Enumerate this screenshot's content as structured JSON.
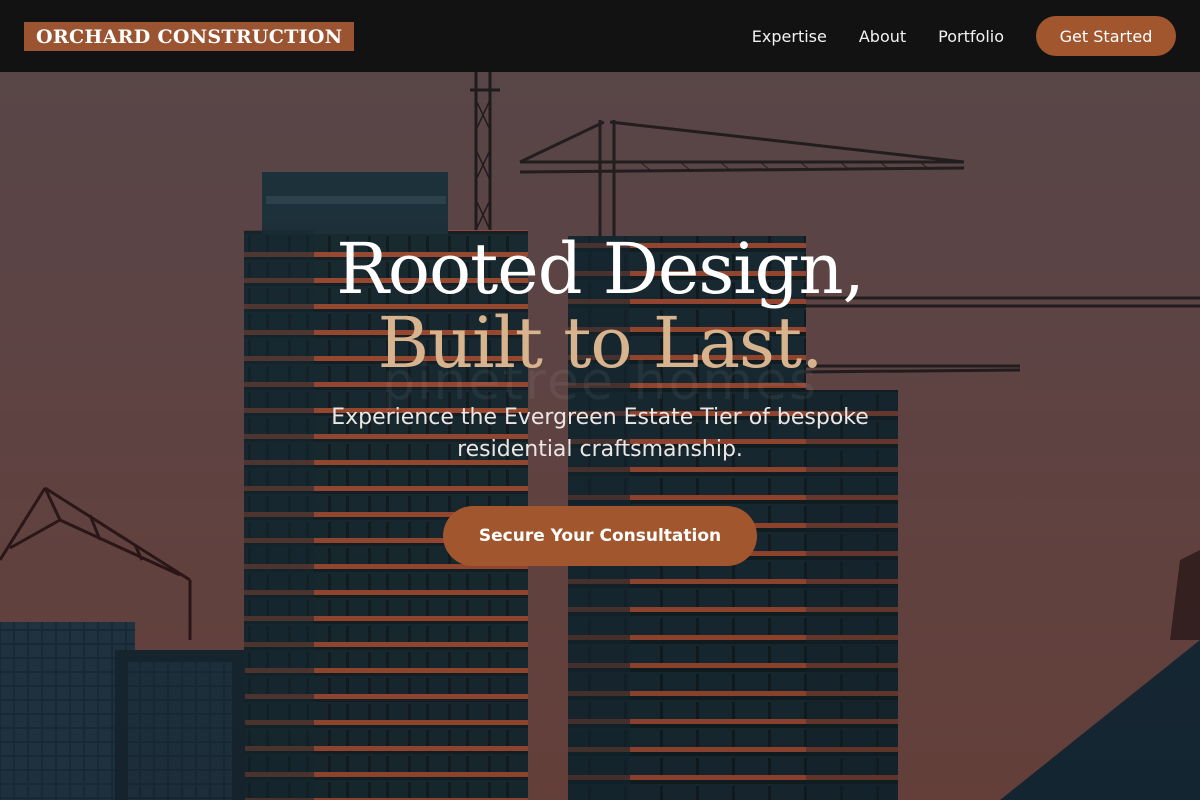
{
  "brand": {
    "name": "ORCHARD CONSTRUCTION",
    "color": "#9a5431"
  },
  "nav": {
    "links": [
      {
        "label": "Expertise"
      },
      {
        "label": "About"
      },
      {
        "label": "Portfolio"
      }
    ],
    "cta_label": "Get Started"
  },
  "hero": {
    "headline_line_1": "Rooted Design,",
    "headline_line_2": "Built to Last.",
    "subheadline": "Experience the Evergreen Estate Tier of bespoke residential craftsmanship.",
    "cta_label": "Secure Your Consultation",
    "watermark": "pinetree homes",
    "background_image": "construction-skyline-photo"
  },
  "colors": {
    "accent": "#a2562e",
    "headline_accent": "#d8b48e",
    "navbar": "#111010"
  }
}
